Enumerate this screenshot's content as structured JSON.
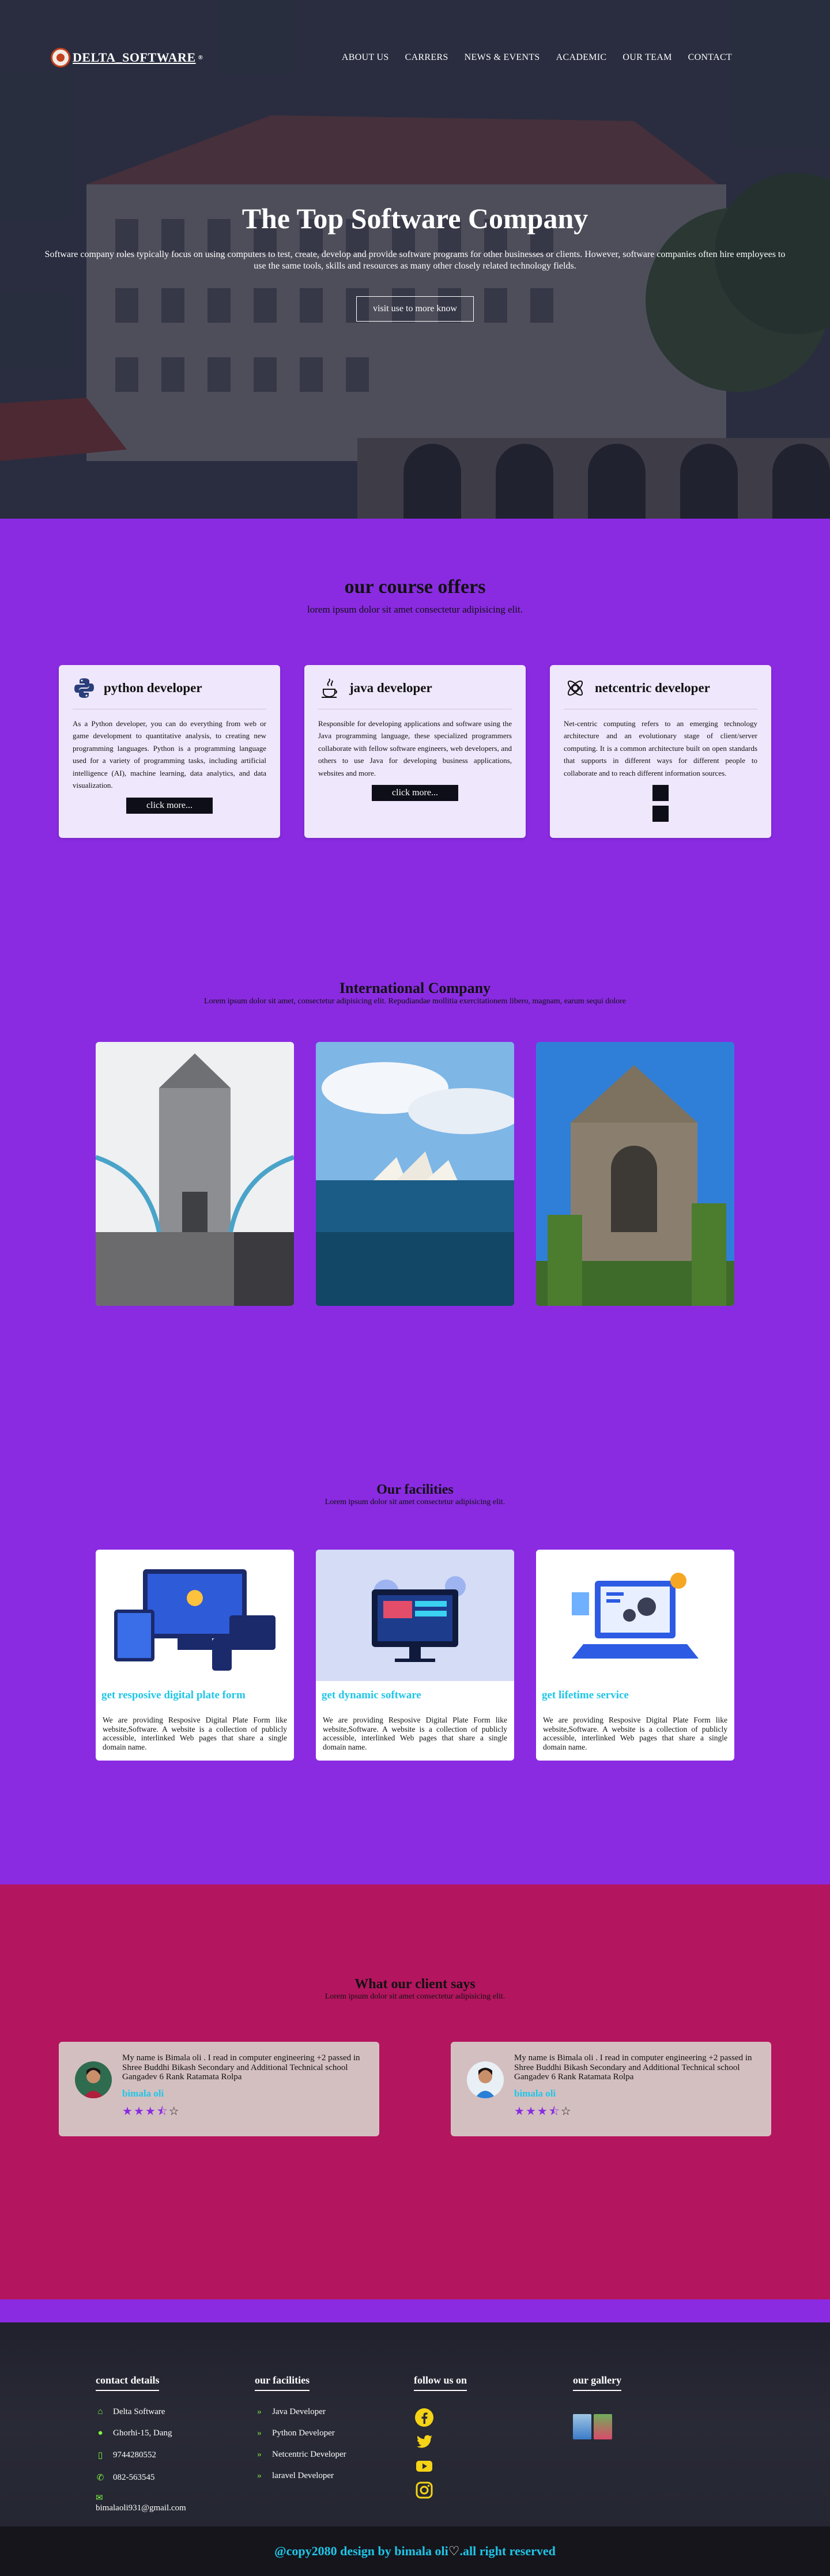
{
  "header": {
    "logo_text": "DELTA_SOFTWARE",
    "logo_reg": "®",
    "menu": [
      "ABOUT US",
      "CARRERS",
      "NEWS & EVENTS",
      "ACADEMIC",
      "OUR TEAM",
      "CONTACT"
    ]
  },
  "hero": {
    "title": "The Top Software Company",
    "text": "Software company roles typically focus on using computers to test, create, develop and provide software programs for other businesses or clients. However, software companies often hire employees to use the same tools, skills and resources as many other closely related technology fields.",
    "button": "visit use to more know"
  },
  "courses": {
    "title": "our course offers",
    "subtitle": "lorem ipsum dolor sit amet consectetur adipisicing elit.",
    "cards": [
      {
        "icon": "python-icon",
        "title": "python developer",
        "text": "As a Python developer, you can do everything from web or game development to quantitative analysis, to creating new programming languages. Python is a programming language used for a variety of programming tasks, including artificial intelligence (AI), machine learning, data analytics, and data visualization.",
        "button": "click more..."
      },
      {
        "icon": "java-icon",
        "title": "java developer",
        "text": "Responsible for developing applications and software using the Java programming language, these specialized programmers collaborate with fellow software engineers, web developers, and others to use Java for developing business applications, websites and more.",
        "button": "click more..."
      },
      {
        "icon": "netcentric-icon",
        "title": "netcentric developer",
        "text": "Net-centric computing refers to an emerging technology architecture and an evolutionary stage of client/server computing. It is a common architecture built on open standards that supports in different ways for different people to collaborate and to reach different information sources."
      }
    ]
  },
  "international": {
    "title": "International Company",
    "subtitle": "Lorem ipsum dolor sit amet, consectetur adipisicing elit. Repudiandae mollitia exercitationem libero, magnam, earum sequi dolore"
  },
  "facilities": {
    "title": "Our facilities",
    "subtitle": "Lorem ipsum dolor sit amet consectetur adipisicing elit.",
    "cards": [
      {
        "title": "get resposive digital plate form",
        "text": "We are providing Resposive Digital Plate Form like website,Software. A website is a collection of publicly accessible, interlinked Web pages that share a single domain name."
      },
      {
        "title": "get dynamic software",
        "text": "We are providing Resposive Digital Plate Form like website,Software. A website is a collection of publicly accessible, interlinked Web pages that share a single domain name."
      },
      {
        "title": "get lifetime service",
        "text": "We are providing Resposive Digital Plate Form like website,Software. A website is a collection of publicly accessible, interlinked Web pages that share a single domain name."
      }
    ]
  },
  "clients": {
    "title": "What our client says",
    "subtitle": "Lorem ipsum dolor sit amet consectetur adipisicing elit.",
    "cards": [
      {
        "text": "My name is Bimala oli . I read in computer engineering +2 passed in Shree Buddhi Bikash Secondary and Additional Technical school Gangadev 6 Rank Ratamata Rolpa",
        "name": "bimala oli",
        "rating": 3.5
      },
      {
        "text": "My name is Bimala oli . I read in computer engineering +2 passed in Shree Buddhi Bikash Secondary and Additional Technical school Gangadev 6 Rank Ratamata Rolpa",
        "name": "bimala oli",
        "rating": 3.5
      }
    ]
  },
  "footer": {
    "contact": {
      "title": "contact details",
      "items": [
        "Delta Software",
        "Ghorhi-15, Dang",
        "9744280552",
        "082-563545"
      ],
      "email": "bimalaoli931@gmail.com"
    },
    "facilities": {
      "title": "our facilities",
      "items": [
        "Java Developer",
        "Python Developer",
        "Netcentric Developer",
        "laravel Developer"
      ]
    },
    "follow": {
      "title": "follow us on",
      "icons": [
        "facebook-icon",
        "twitter-icon",
        "youtube-icon",
        "instagram-icon"
      ]
    },
    "gallery": {
      "title": "our gallery"
    },
    "copyright_left": "@copy2080 design by bimala oli",
    "copyright_right": ".all right reserved"
  },
  "colors": {
    "purple": "#8a2be2",
    "magenta": "#b4155f",
    "cyan": "#1fc6e8",
    "green_icon": "#7cf542"
  }
}
